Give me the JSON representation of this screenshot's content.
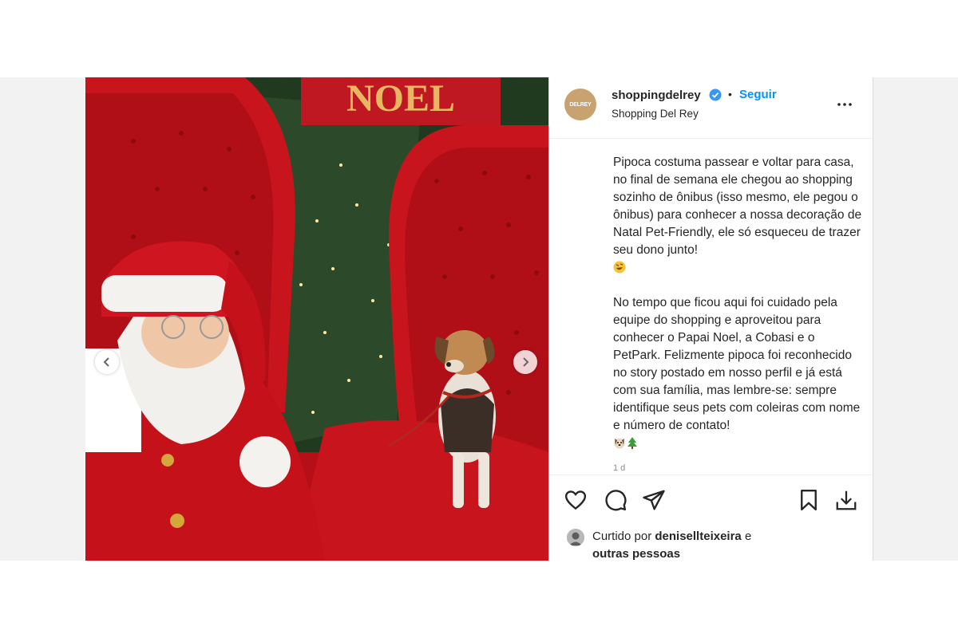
{
  "post": {
    "username": "shoppingdelrey",
    "verified": true,
    "separator": "•",
    "follow_label": "Seguir",
    "subname": "Shopping Del Rey",
    "avatar_logo_text": "DELREY",
    "more_icon": "more-horizontal-icon",
    "media_sign_text": "NOEL",
    "caption_paragraph_1": "Pipoca costuma passear e voltar para casa, no final de semana ele chegou ao shopping sozinho de ônibus (isso mesmo, ele pegou o ônibus) para conhecer a nossa decoração de Natal Pet-Friendly, ele só esqueceu de trazer seu dono junto!",
    "caption_paragraph_2": "No tempo que ficou aqui foi cuidado pela equipe do shopping e aproveitou para conhecer o Papai Noel, a Cobasi e o PetPark. Felizmente pipoca foi reconhecido no story postado em nosso perfil e já está com sua família, mas lembre-se: sempre identifique seus pets com coleiras com nome e número de contato!",
    "caption_emoji_1": "rolling-on-floor-laughing-emoji",
    "caption_emoji_2": [
      "dog-face-emoji",
      "christmas-tree-emoji"
    ],
    "timestamp_partial": "1 d",
    "liked_by_prefix": "Curtido por ",
    "liked_by_user": "denisellteixeira",
    "liked_by_suffix": " e",
    "liked_by_others": "outras pessoas",
    "colors": {
      "accent": "#0095f6",
      "verified": "#3897f0",
      "santa_red": "#c8141c",
      "text": "#262626"
    }
  },
  "icons": {
    "like": "heart-icon",
    "comment": "comment-icon",
    "share": "paper-plane-icon",
    "save": "bookmark-icon",
    "download": "download-icon",
    "prev": "chevron-left-icon",
    "next": "chevron-right-icon"
  }
}
